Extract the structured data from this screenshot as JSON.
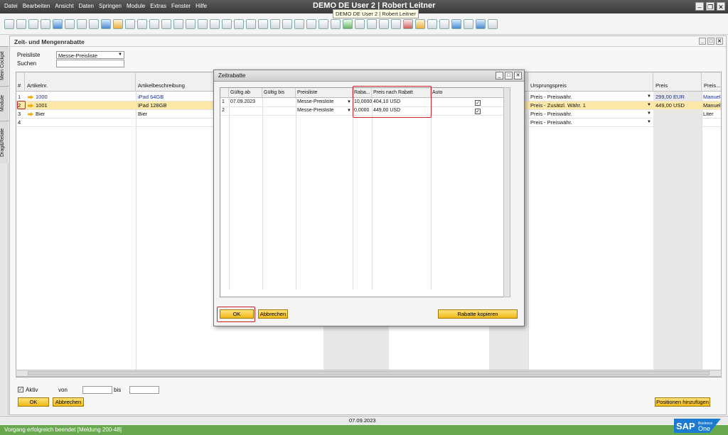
{
  "app": {
    "menu": [
      "Datei",
      "Bearbeiten",
      "Ansicht",
      "Daten",
      "Springen",
      "Module",
      "Extras",
      "Fenster",
      "Hilfe"
    ],
    "title": "DEMO DE User 2 | Robert Leitner",
    "tooltip": "DEMO DE User 2 | Robert Leitner"
  },
  "side_tabs": [
    "Mein Cockpit",
    "Module",
    "Drag&Relate"
  ],
  "window": {
    "title": "Zeit- und Mengenrabatte",
    "preisliste_label": "Preisliste",
    "preisliste_value": "Messe-Preisliste",
    "suchen_label": "Suchen",
    "columns": [
      "#",
      "Artikelnr.",
      "Artikelbeschreibung",
      "Ursprungspreis",
      "Preis",
      "Preis..."
    ],
    "rows": [
      {
        "num": "1",
        "artnr": "1000",
        "desc": "iPad 64GB",
        "ursprung": "Preis - Preiswähr.",
        "preis": "299,00 EUR",
        "einheit": "Manuell"
      },
      {
        "num": "2",
        "artnr": "1001",
        "desc": "iPad 128GB",
        "ursprung": "Preis - Zusätzl. Währ. 1",
        "preis": "449,00 USD",
        "einheit": "Manuell"
      },
      {
        "num": "3",
        "artnr": "Bier",
        "desc": "Bier",
        "ursprung": "Preis - Preiswähr.",
        "preis": "",
        "einheit": "Liter"
      },
      {
        "num": "4",
        "artnr": "",
        "desc": "",
        "ursprung": "Preis - Preiswähr.",
        "preis": "",
        "einheit": ""
      }
    ],
    "aktiv_label": "Aktiv",
    "von_label": "von",
    "bis_label": "bis",
    "ok_label": "OK",
    "abbrechen_label": "Abbrechen",
    "positionen_label": "Positionen hinzufügen"
  },
  "dialog": {
    "title": "Zeitrabatte",
    "columns": [
      "Gültig ab",
      "Gültig bis",
      "Preisliste",
      "Raba...",
      "Preis nach Rabatt",
      "Auto"
    ],
    "rows": [
      {
        "num": "1",
        "ab": "07.09.2023",
        "bis": "",
        "liste": "Messe-Preisliste",
        "rabatt": "10,0000",
        "preis": "404,10 USD",
        "auto": true
      },
      {
        "num": "2",
        "ab": "",
        "bis": "",
        "liste": "Messe-Preisliste",
        "rabatt": "0,0000",
        "preis": "449,00 USD",
        "auto": true
      }
    ],
    "ok_label": "OK",
    "abbrechen_label": "Abbrechen",
    "kopieren_label": "Rabatte kopieren"
  },
  "status": {
    "date": "07.09.2023",
    "message": "Vorgang erfolgreich beendet  [Meldung 200-48]"
  },
  "colors": {
    "accent": "#f0b818",
    "highlight": "#d0202a",
    "status_green": "#6aa84f"
  }
}
